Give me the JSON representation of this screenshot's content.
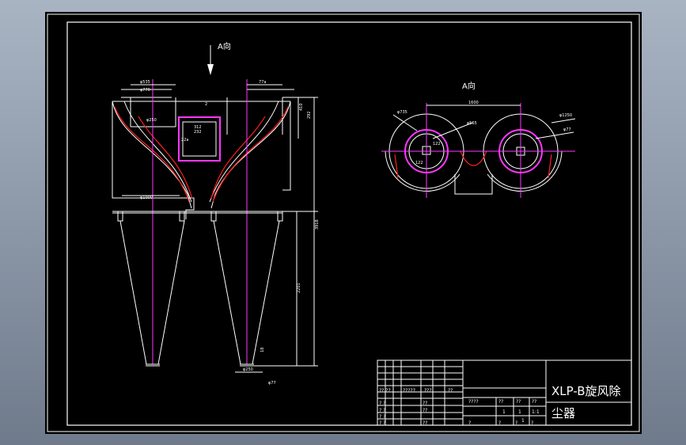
{
  "labels": {
    "a_direction_front": "A向",
    "a_direction_top": "A向"
  },
  "dimensions": {
    "d1": "φ535",
    "d2": "φ770",
    "d3": "φ250",
    "d4": "77a",
    "d5": "312",
    "d6": "232",
    "d7": "410",
    "d8": "2",
    "d9": "292",
    "d10": "22a",
    "d11": "φ1000",
    "d12": "3918",
    "d13": "2201",
    "d14": "18",
    "d15": "φ250",
    "d16": "φ77",
    "d17": "1600",
    "d18": "φ1250",
    "d19": "φ735",
    "d20": "φ565",
    "d21": "122",
    "d22": "122",
    "d23": "φ25 …"
  },
  "title_block": {
    "title_line1": "XLP-B旋风除",
    "title_line2": "尘器",
    "row_headers": [
      "?? ??",
      "?????",
      "???",
      "??"
    ],
    "mid_row": [
      "????",
      "??",
      "??",
      "??"
    ],
    "vals": [
      "1",
      "1",
      "1",
      "1:1"
    ],
    "left_cells": [
      "? ?",
      "? ?",
      "? ?",
      "? ?",
      "? ?"
    ],
    "sub_cells": [
      "??",
      "??",
      "??"
    ],
    "bottom": [
      "?",
      "?",
      "?",
      "?"
    ]
  },
  "colors": {
    "background": "#000000",
    "line": "#ffffff",
    "centerline": "#ff37ff",
    "section": "#ff2020"
  }
}
